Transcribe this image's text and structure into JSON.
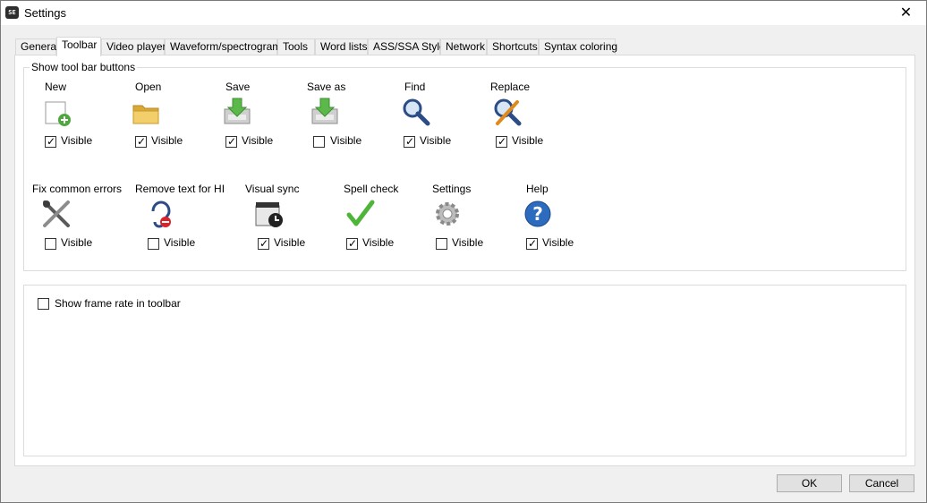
{
  "window": {
    "title": "Settings",
    "app_icon_text": "SE",
    "close_glyph": "✕"
  },
  "tabs": [
    {
      "label": "General",
      "active": false
    },
    {
      "label": "Toolbar",
      "active": true
    },
    {
      "label": "Video player",
      "active": false
    },
    {
      "label": "Waveform/spectrogram",
      "active": false
    },
    {
      "label": "Tools",
      "active": false
    },
    {
      "label": "Word lists",
      "active": false
    },
    {
      "label": "ASS/SSA Style",
      "active": false
    },
    {
      "label": "Network",
      "active": false
    },
    {
      "label": "Shortcuts",
      "active": false
    },
    {
      "label": "Syntax coloring",
      "active": false
    }
  ],
  "toolbar_group": {
    "title": "Show tool bar buttons",
    "visible_label": "Visible",
    "tools": [
      {
        "label": "New",
        "icon": "new-file-icon",
        "checked": true
      },
      {
        "label": "Open",
        "icon": "folder-icon",
        "checked": true
      },
      {
        "label": "Save",
        "icon": "save-icon",
        "checked": true
      },
      {
        "label": "Save as",
        "icon": "save-as-icon",
        "checked": false
      },
      {
        "label": "Find",
        "icon": "magnifier-icon",
        "checked": true
      },
      {
        "label": "Replace",
        "icon": "replace-icon",
        "checked": true
      },
      {
        "label": "Fix common errors",
        "icon": "tools-icon",
        "checked": false
      },
      {
        "label": "Remove text for HI",
        "icon": "hearing-icon",
        "checked": false
      },
      {
        "label": "Visual sync",
        "icon": "visual-sync-icon",
        "checked": true
      },
      {
        "label": "Spell check",
        "icon": "checkmark-icon",
        "checked": true
      },
      {
        "label": "Settings",
        "icon": "gear-icon",
        "checked": false
      },
      {
        "label": "Help",
        "icon": "help-icon",
        "checked": true
      }
    ]
  },
  "frame_rate": {
    "label": "Show frame rate in toolbar",
    "checked": false
  },
  "buttons": {
    "ok": "OK",
    "cancel": "Cancel"
  },
  "check_glyph": "✓"
}
